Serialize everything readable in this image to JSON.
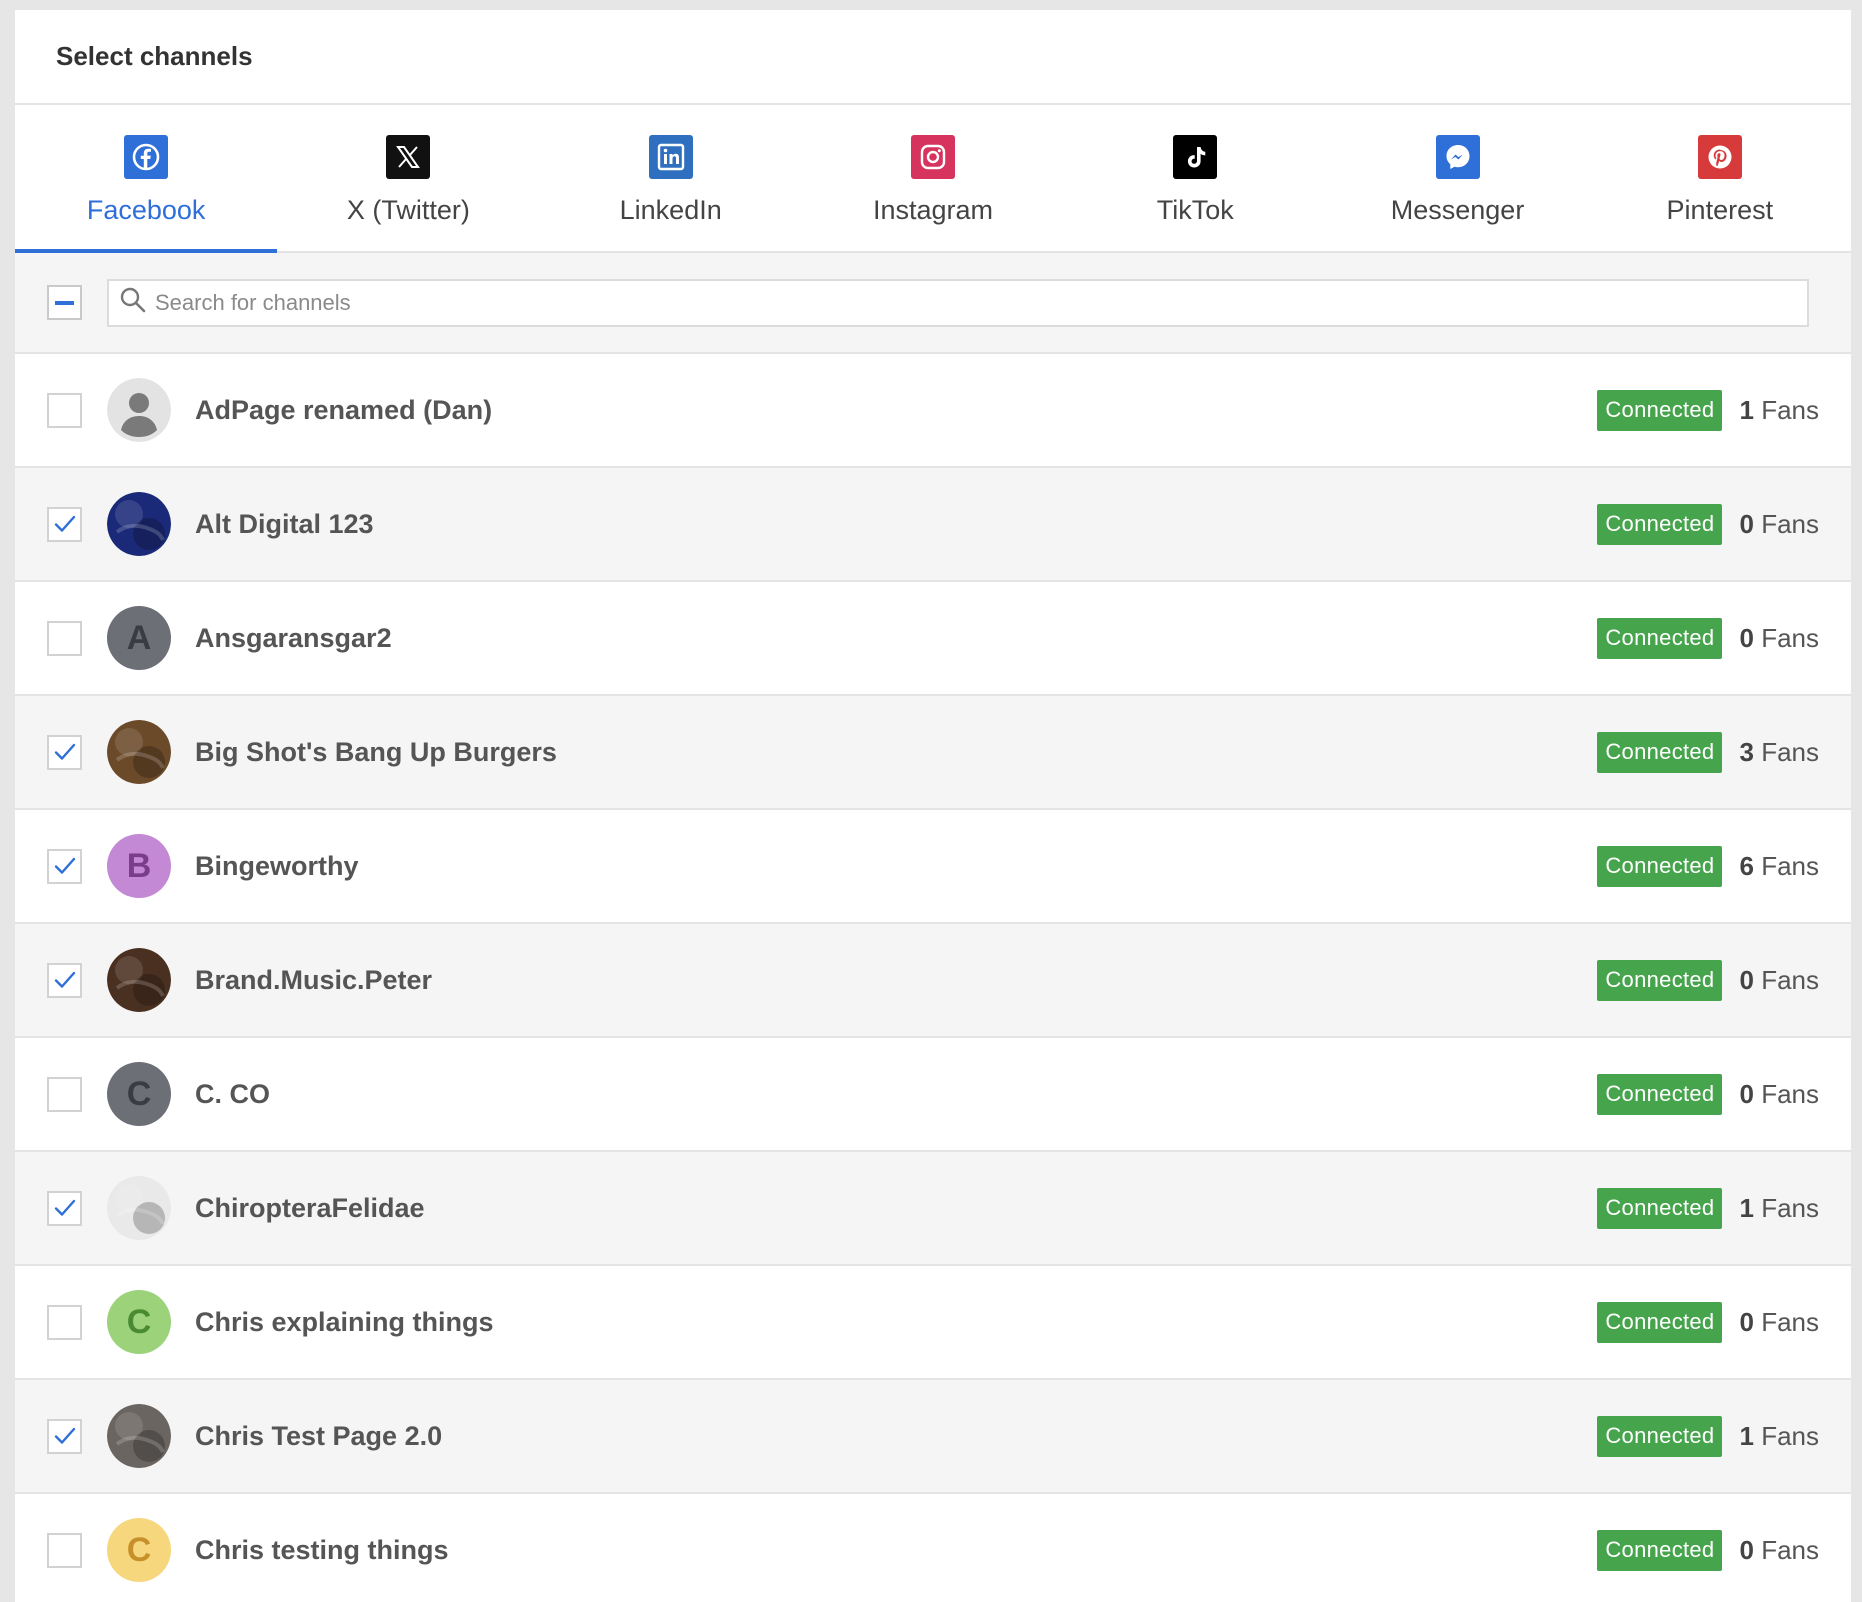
{
  "header": {
    "title": "Select channels"
  },
  "tabs": [
    {
      "label": "Facebook",
      "icon": "facebook-icon",
      "color": "#2f6fd8",
      "active": true
    },
    {
      "label": "X (Twitter)",
      "icon": "x-twitter-icon",
      "color": "#111111",
      "active": false
    },
    {
      "label": "LinkedIn",
      "icon": "linkedin-icon",
      "color": "#2f6fbf",
      "active": false
    },
    {
      "label": "Instagram",
      "icon": "instagram-icon",
      "color": "#d6335f",
      "active": false
    },
    {
      "label": "TikTok",
      "icon": "tiktok-icon",
      "color": "#000000",
      "active": false
    },
    {
      "label": "Messenger",
      "icon": "messenger-icon",
      "color": "#2f6fd8",
      "active": false
    },
    {
      "label": "Pinterest",
      "icon": "pinterest-icon",
      "color": "#d63a3a",
      "active": false
    }
  ],
  "search": {
    "placeholder": "Search for channels",
    "select_all_state": "indeterminate"
  },
  "status_color": "#46a44d",
  "channels": [
    {
      "name": "AdPage renamed (Dan)",
      "checked": false,
      "status": "Connected",
      "fans_count": "1",
      "fans_label": "Fans",
      "avatar": {
        "type": "default-user"
      }
    },
    {
      "name": "Alt Digital 123",
      "checked": true,
      "status": "Connected",
      "fans_count": "0",
      "fans_label": "Fans",
      "avatar": {
        "type": "photo",
        "bg": "#1b2a78"
      }
    },
    {
      "name": "Ansgaransgar2",
      "checked": false,
      "status": "Connected",
      "fans_count": "0",
      "fans_label": "Fans",
      "avatar": {
        "type": "letter",
        "letter": "A",
        "bg": "#6d6f76",
        "fg": "#3a3c44"
      }
    },
    {
      "name": "Big Shot's Bang Up Burgers",
      "checked": true,
      "status": "Connected",
      "fans_count": "3",
      "fans_label": "Fans",
      "avatar": {
        "type": "photo",
        "bg": "#6b4a2a"
      }
    },
    {
      "name": "Bingeworthy",
      "checked": true,
      "status": "Connected",
      "fans_count": "6",
      "fans_label": "Fans",
      "avatar": {
        "type": "letter",
        "letter": "B",
        "bg": "#c389d4",
        "fg": "#7a3d8c"
      }
    },
    {
      "name": "Brand.Music.Peter",
      "checked": true,
      "status": "Connected",
      "fans_count": "0",
      "fans_label": "Fans",
      "avatar": {
        "type": "photo",
        "bg": "#4a3020"
      }
    },
    {
      "name": "C. CO",
      "checked": false,
      "status": "Connected",
      "fans_count": "0",
      "fans_label": "Fans",
      "avatar": {
        "type": "letter",
        "letter": "C",
        "bg": "#6d6f76",
        "fg": "#3a3c44"
      }
    },
    {
      "name": "ChiropteraFelidae",
      "checked": true,
      "status": "Connected",
      "fans_count": "1",
      "fans_label": "Fans",
      "avatar": {
        "type": "photo",
        "bg": "#e9e9e9"
      }
    },
    {
      "name": "Chris explaining things",
      "checked": false,
      "status": "Connected",
      "fans_count": "0",
      "fans_label": "Fans",
      "avatar": {
        "type": "letter",
        "letter": "C",
        "bg": "#9cd27a",
        "fg": "#4a8a32"
      }
    },
    {
      "name": "Chris Test Page 2.0",
      "checked": true,
      "status": "Connected",
      "fans_count": "1",
      "fans_label": "Fans",
      "avatar": {
        "type": "photo",
        "bg": "#6a6560"
      }
    },
    {
      "name": "Chris testing things",
      "checked": false,
      "status": "Connected",
      "fans_count": "0",
      "fans_label": "Fans",
      "avatar": {
        "type": "letter",
        "letter": "C",
        "bg": "#f6d77e",
        "fg": "#c8902a"
      }
    }
  ]
}
